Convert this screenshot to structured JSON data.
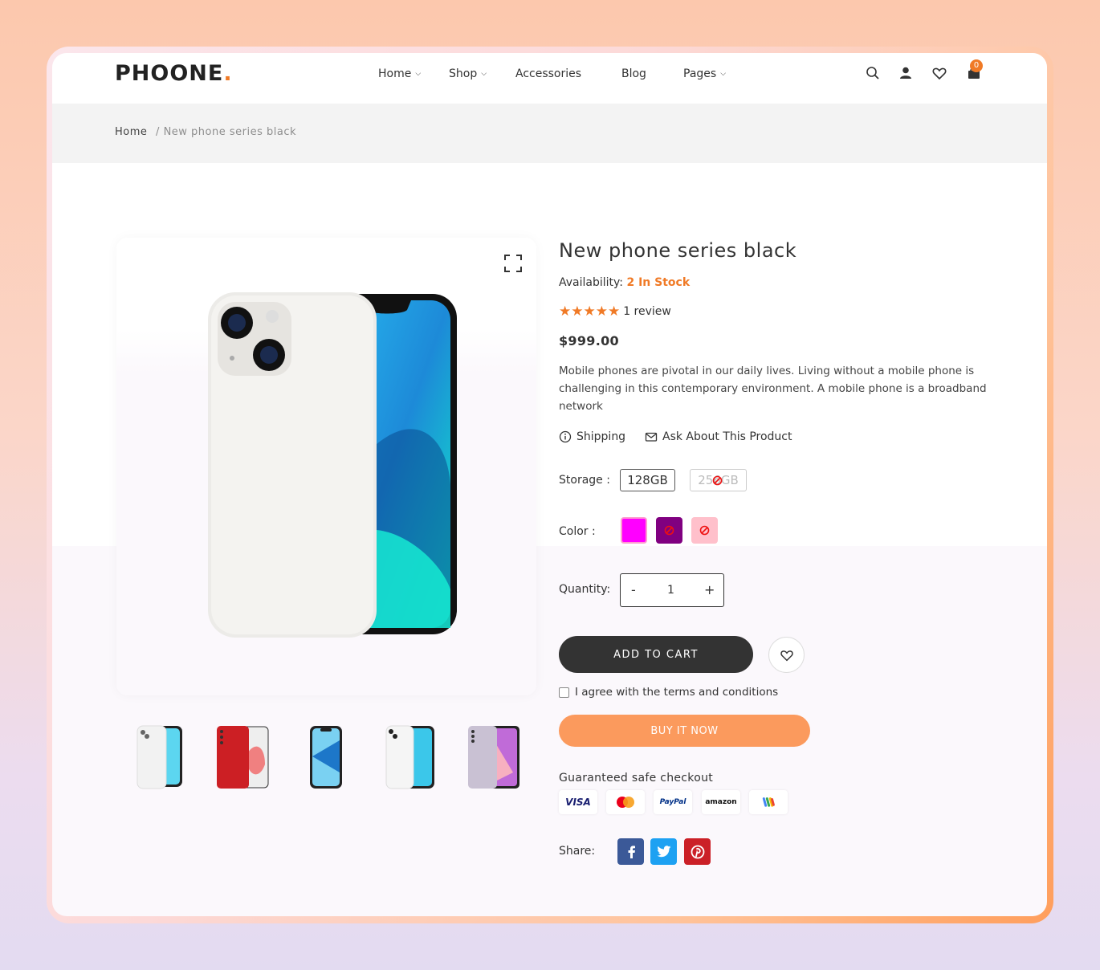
{
  "brand": {
    "logo_text": "PHOONE",
    "logo_dot": ".",
    "accent_color": "#f07a26"
  },
  "nav": {
    "items": [
      {
        "label": "Home",
        "has_dropdown": true
      },
      {
        "label": "Shop",
        "has_dropdown": true
      },
      {
        "label": "Accessories",
        "has_dropdown": false
      },
      {
        "label": "Blog",
        "has_dropdown": false
      },
      {
        "label": "Pages",
        "has_dropdown": true
      }
    ],
    "icons": [
      "search-icon",
      "user-icon",
      "heart-icon",
      "cart-icon"
    ],
    "cart_count": "0"
  },
  "breadcrumb": {
    "home": "Home",
    "separator": "/",
    "current": "New phone series black"
  },
  "product": {
    "title": "New phone series black",
    "availability_label": "Availability:",
    "availability_value": "2 In Stock",
    "rating_stars": 5,
    "review_text": "1 review",
    "price": "$999.00",
    "description": "Mobile phones are pivotal in our daily lives. Living without a mobile phone is challenging in this contemporary environment. A mobile phone is a broadband network",
    "links": {
      "shipping": "Shipping",
      "ask": "Ask About This Product"
    },
    "storage": {
      "label": "Storage :",
      "options": [
        {
          "label": "128GB",
          "available": true
        },
        {
          "label": "256GB",
          "available": false
        }
      ]
    },
    "color": {
      "label": "Color :",
      "options": [
        {
          "hex": "#ff00ff",
          "available": true,
          "selected": true
        },
        {
          "hex": "#800080",
          "available": false
        },
        {
          "hex": "#ffc0cb",
          "available": false
        }
      ]
    },
    "quantity": {
      "label": "Quantity:",
      "minus": "-",
      "value": "1",
      "plus": "+"
    },
    "add_to_cart": "ADD TO CART",
    "terms": "I agree with the terms and conditions",
    "buy_now": "BUY IT NOW",
    "checkout_label": "Guaranteed safe checkout",
    "payments": [
      {
        "name": "VISA",
        "color": "#1a1f71"
      },
      {
        "name": "mastercard",
        "color": "#eb001b"
      },
      {
        "name": "PayPal",
        "color": "#003087"
      },
      {
        "name": "amazon",
        "color": "#111111"
      },
      {
        "name": "google-wallet",
        "color": "#4285f4"
      }
    ],
    "share_label": "Share:",
    "social": [
      {
        "name": "facebook-icon",
        "glyph": "f",
        "color": "#3b5998"
      },
      {
        "name": "twitter-icon",
        "glyph": "t",
        "color": "#1da1f2"
      },
      {
        "name": "pinterest-icon",
        "glyph": "p",
        "color": "#cb2027"
      }
    ]
  },
  "gallery": {
    "thumbnails": [
      "thumb-white-blue-phone",
      "thumb-red-phone",
      "thumb-blue-phone",
      "thumb-white-blue-phone-2",
      "thumb-purple-phone"
    ]
  }
}
